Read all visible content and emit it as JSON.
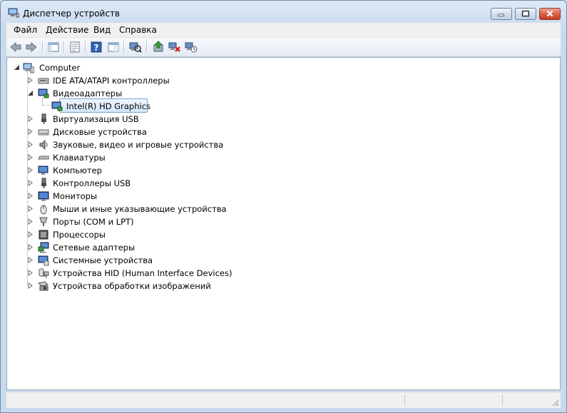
{
  "window": {
    "title": "Диспетчер устройств",
    "controls": [
      "minimize",
      "maximize",
      "close"
    ]
  },
  "menu": {
    "items": [
      {
        "label": "Файл"
      },
      {
        "label": "Действие"
      },
      {
        "label": "Вид"
      },
      {
        "label": "Справка"
      }
    ]
  },
  "toolbar": {
    "buttons": [
      "back-arrow-icon",
      "forward-arrow-icon",
      "show-hide-tree-icon",
      "properties-icon",
      "help-icon",
      "console-view-icon",
      "scan-hardware-icon",
      "update-driver-icon",
      "uninstall-device-icon",
      "disable-device-icon"
    ]
  },
  "tree": {
    "root": {
      "label": "Computer",
      "expanded": true
    },
    "categories": [
      {
        "label": "IDE ATA/ATAPI контроллеры",
        "expanded": false,
        "icon": "ide-controller-icon"
      },
      {
        "label": "Видеоадаптеры",
        "expanded": true,
        "icon": "display-adapter-icon",
        "children": [
          {
            "label": "Intel(R) HD Graphics",
            "selected": true,
            "icon": "display-adapter-icon"
          }
        ]
      },
      {
        "label": "Виртуализация USB",
        "expanded": false,
        "icon": "usb-icon"
      },
      {
        "label": "Дисковые устройства",
        "expanded": false,
        "icon": "disk-drive-icon"
      },
      {
        "label": "Звуковые, видео и игровые устройства",
        "expanded": false,
        "icon": "speaker-icon"
      },
      {
        "label": "Клавиатуры",
        "expanded": false,
        "icon": "keyboard-icon"
      },
      {
        "label": "Компьютер",
        "expanded": false,
        "icon": "computer-icon"
      },
      {
        "label": "Контроллеры USB",
        "expanded": false,
        "icon": "usb-icon"
      },
      {
        "label": "Мониторы",
        "expanded": false,
        "icon": "monitor-icon"
      },
      {
        "label": "Мыши и иные указывающие устройства",
        "expanded": false,
        "icon": "mouse-icon"
      },
      {
        "label": "Порты (COM и LPT)",
        "expanded": false,
        "icon": "port-icon"
      },
      {
        "label": "Процессоры",
        "expanded": false,
        "icon": "processor-icon"
      },
      {
        "label": "Сетевые адаптеры",
        "expanded": false,
        "icon": "network-adapter-icon"
      },
      {
        "label": "Системные устройства",
        "expanded": false,
        "icon": "system-device-icon"
      },
      {
        "label": "Устройства HID (Human Interface Devices)",
        "expanded": false,
        "icon": "hid-icon"
      },
      {
        "label": "Устройства обработки изображений",
        "expanded": false,
        "icon": "camera-icon"
      }
    ]
  },
  "colors": {
    "selection_border": "#7da2ce",
    "selection_fill": "#d5e6fa",
    "close_button": "#d8644b"
  }
}
